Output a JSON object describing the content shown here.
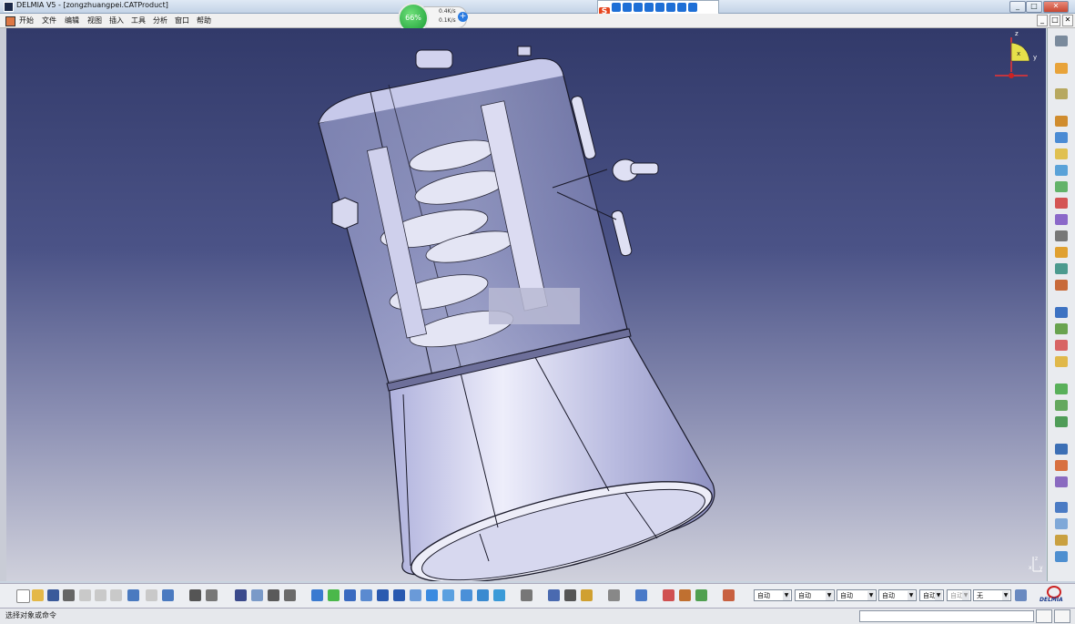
{
  "window": {
    "title": "DELMIA V5 - [zongzhuangpei.CATProduct]",
    "min_label": "_",
    "max_label": "□",
    "close_label": "✕"
  },
  "menu": {
    "items": [
      "开始",
      "文件",
      "编辑",
      "视图",
      "插入",
      "工具",
      "分析",
      "窗口",
      "帮助"
    ],
    "doc_controls": [
      "_",
      "□",
      "✕"
    ]
  },
  "network_widget": {
    "percent": "66%",
    "upload": "0.4K/s",
    "download": "0.1K/s"
  },
  "compass": {
    "x": "x",
    "y": "y",
    "z": "z"
  },
  "corner_axis": {
    "x": "x",
    "y": "y",
    "z": "z"
  },
  "toolbar": {
    "dropdowns": [
      "自动",
      "自动",
      "自动",
      "自动",
      "自动",
      "自动",
      "无"
    ]
  },
  "brand": {
    "logo_text": "DELMIA"
  },
  "status": {
    "prompt": "选择对象或命令"
  },
  "colors": {
    "viewport_top": "#323a6a",
    "viewport_bottom": "#d0d1dc",
    "part_fill": "#c9cbee",
    "part_edge": "#1a1a2a"
  }
}
